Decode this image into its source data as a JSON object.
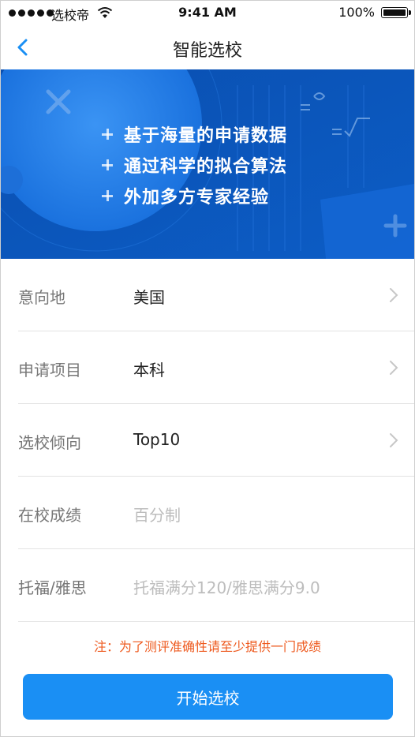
{
  "status_bar": {
    "carrier": "选校帝",
    "time": "9:41 AM",
    "battery": "100%"
  },
  "nav": {
    "title": "智能选校",
    "back_icon": "chevron-left-icon"
  },
  "banner": {
    "lines": [
      "基于海量的申请数据",
      "通过科学的拟合算法",
      "外加多方专家经验"
    ]
  },
  "form": {
    "rows": [
      {
        "label": "意向地",
        "value": "美国",
        "placeholder": "",
        "has_arrow": true
      },
      {
        "label": "申请项目",
        "value": "本科",
        "placeholder": "",
        "has_arrow": true
      },
      {
        "label": "选校倾向",
        "value": "Top10",
        "placeholder": "",
        "has_arrow": true
      },
      {
        "label": "在校成绩",
        "value": "",
        "placeholder": "百分制",
        "has_arrow": false
      },
      {
        "label": "托福/雅思",
        "value": "",
        "placeholder": "托福满分120/雅思满分9.0",
        "has_arrow": false
      }
    ]
  },
  "note": "注：为了测评准确性请至少提供一门成绩",
  "start_button": "开始选校",
  "colors": {
    "accent": "#1a8ff4",
    "banner": "#0b5fc4",
    "note": "#ee5a1f"
  }
}
